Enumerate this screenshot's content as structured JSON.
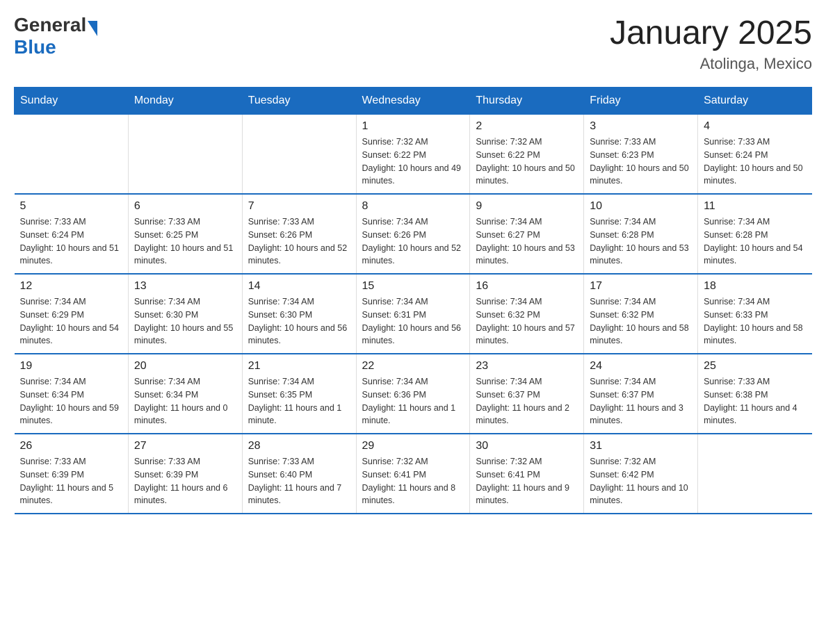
{
  "header": {
    "logo_general": "General",
    "logo_blue": "Blue",
    "title": "January 2025",
    "subtitle": "Atolinga, Mexico"
  },
  "days_of_week": [
    "Sunday",
    "Monday",
    "Tuesday",
    "Wednesday",
    "Thursday",
    "Friday",
    "Saturday"
  ],
  "weeks": [
    [
      {
        "day": "",
        "info": ""
      },
      {
        "day": "",
        "info": ""
      },
      {
        "day": "",
        "info": ""
      },
      {
        "day": "1",
        "info": "Sunrise: 7:32 AM\nSunset: 6:22 PM\nDaylight: 10 hours and 49 minutes."
      },
      {
        "day": "2",
        "info": "Sunrise: 7:32 AM\nSunset: 6:22 PM\nDaylight: 10 hours and 50 minutes."
      },
      {
        "day": "3",
        "info": "Sunrise: 7:33 AM\nSunset: 6:23 PM\nDaylight: 10 hours and 50 minutes."
      },
      {
        "day": "4",
        "info": "Sunrise: 7:33 AM\nSunset: 6:24 PM\nDaylight: 10 hours and 50 minutes."
      }
    ],
    [
      {
        "day": "5",
        "info": "Sunrise: 7:33 AM\nSunset: 6:24 PM\nDaylight: 10 hours and 51 minutes."
      },
      {
        "day": "6",
        "info": "Sunrise: 7:33 AM\nSunset: 6:25 PM\nDaylight: 10 hours and 51 minutes."
      },
      {
        "day": "7",
        "info": "Sunrise: 7:33 AM\nSunset: 6:26 PM\nDaylight: 10 hours and 52 minutes."
      },
      {
        "day": "8",
        "info": "Sunrise: 7:34 AM\nSunset: 6:26 PM\nDaylight: 10 hours and 52 minutes."
      },
      {
        "day": "9",
        "info": "Sunrise: 7:34 AM\nSunset: 6:27 PM\nDaylight: 10 hours and 53 minutes."
      },
      {
        "day": "10",
        "info": "Sunrise: 7:34 AM\nSunset: 6:28 PM\nDaylight: 10 hours and 53 minutes."
      },
      {
        "day": "11",
        "info": "Sunrise: 7:34 AM\nSunset: 6:28 PM\nDaylight: 10 hours and 54 minutes."
      }
    ],
    [
      {
        "day": "12",
        "info": "Sunrise: 7:34 AM\nSunset: 6:29 PM\nDaylight: 10 hours and 54 minutes."
      },
      {
        "day": "13",
        "info": "Sunrise: 7:34 AM\nSunset: 6:30 PM\nDaylight: 10 hours and 55 minutes."
      },
      {
        "day": "14",
        "info": "Sunrise: 7:34 AM\nSunset: 6:30 PM\nDaylight: 10 hours and 56 minutes."
      },
      {
        "day": "15",
        "info": "Sunrise: 7:34 AM\nSunset: 6:31 PM\nDaylight: 10 hours and 56 minutes."
      },
      {
        "day": "16",
        "info": "Sunrise: 7:34 AM\nSunset: 6:32 PM\nDaylight: 10 hours and 57 minutes."
      },
      {
        "day": "17",
        "info": "Sunrise: 7:34 AM\nSunset: 6:32 PM\nDaylight: 10 hours and 58 minutes."
      },
      {
        "day": "18",
        "info": "Sunrise: 7:34 AM\nSunset: 6:33 PM\nDaylight: 10 hours and 58 minutes."
      }
    ],
    [
      {
        "day": "19",
        "info": "Sunrise: 7:34 AM\nSunset: 6:34 PM\nDaylight: 10 hours and 59 minutes."
      },
      {
        "day": "20",
        "info": "Sunrise: 7:34 AM\nSunset: 6:34 PM\nDaylight: 11 hours and 0 minutes."
      },
      {
        "day": "21",
        "info": "Sunrise: 7:34 AM\nSunset: 6:35 PM\nDaylight: 11 hours and 1 minute."
      },
      {
        "day": "22",
        "info": "Sunrise: 7:34 AM\nSunset: 6:36 PM\nDaylight: 11 hours and 1 minute."
      },
      {
        "day": "23",
        "info": "Sunrise: 7:34 AM\nSunset: 6:37 PM\nDaylight: 11 hours and 2 minutes."
      },
      {
        "day": "24",
        "info": "Sunrise: 7:34 AM\nSunset: 6:37 PM\nDaylight: 11 hours and 3 minutes."
      },
      {
        "day": "25",
        "info": "Sunrise: 7:33 AM\nSunset: 6:38 PM\nDaylight: 11 hours and 4 minutes."
      }
    ],
    [
      {
        "day": "26",
        "info": "Sunrise: 7:33 AM\nSunset: 6:39 PM\nDaylight: 11 hours and 5 minutes."
      },
      {
        "day": "27",
        "info": "Sunrise: 7:33 AM\nSunset: 6:39 PM\nDaylight: 11 hours and 6 minutes."
      },
      {
        "day": "28",
        "info": "Sunrise: 7:33 AM\nSunset: 6:40 PM\nDaylight: 11 hours and 7 minutes."
      },
      {
        "day": "29",
        "info": "Sunrise: 7:32 AM\nSunset: 6:41 PM\nDaylight: 11 hours and 8 minutes."
      },
      {
        "day": "30",
        "info": "Sunrise: 7:32 AM\nSunset: 6:41 PM\nDaylight: 11 hours and 9 minutes."
      },
      {
        "day": "31",
        "info": "Sunrise: 7:32 AM\nSunset: 6:42 PM\nDaylight: 11 hours and 10 minutes."
      },
      {
        "day": "",
        "info": ""
      }
    ]
  ]
}
